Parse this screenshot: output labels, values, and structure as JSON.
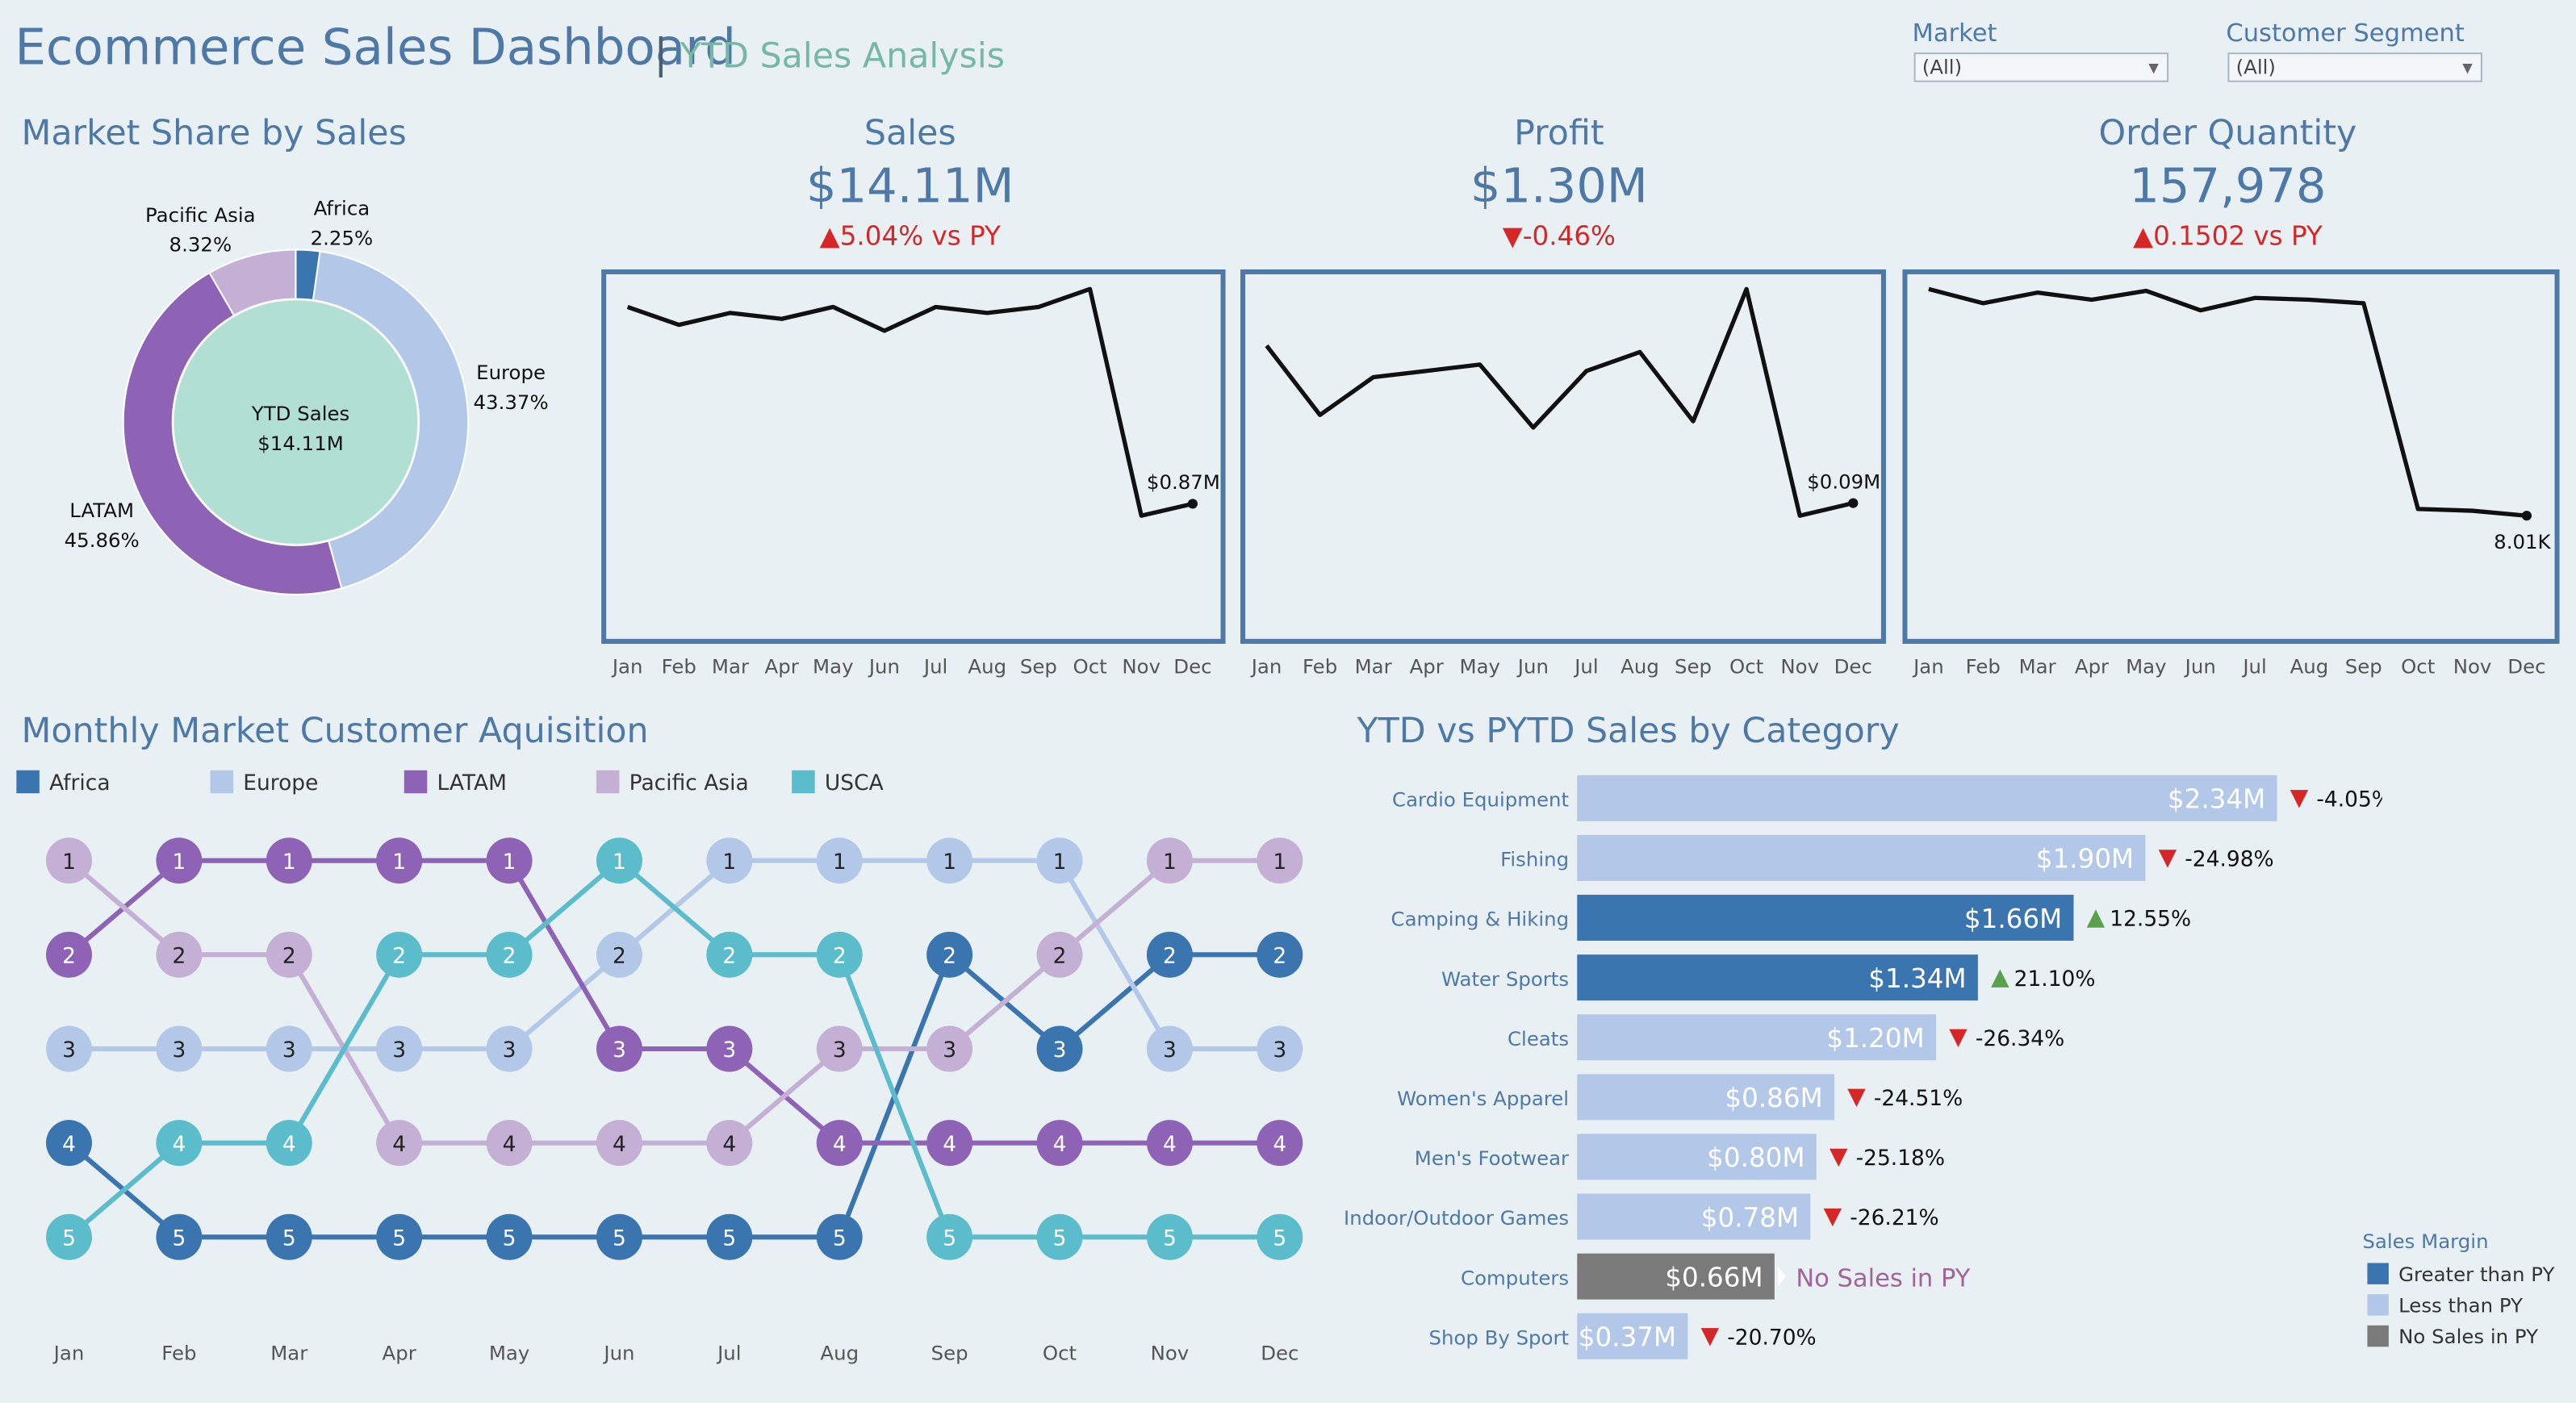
{
  "header": {
    "title": "Ecommerce Sales Dashboard",
    "separator": "|",
    "subtitle": "YTD Sales Analysis"
  },
  "filters": [
    {
      "label": "Market",
      "value": "(All)"
    },
    {
      "label": "Customer Segment",
      "value": "(All)"
    }
  ],
  "market_share": {
    "title": "Market Share by Sales",
    "center_label": "YTD Sales",
    "center_value": "$14.11M",
    "labels": [
      {
        "name": "Pacific Asia",
        "pct": "8.32%"
      },
      {
        "name": "Africa",
        "pct": "2.25%"
      },
      {
        "name": "Europe",
        "pct": "43.37%"
      },
      {
        "name": "LATAM",
        "pct": "45.86%"
      }
    ]
  },
  "kpis": [
    {
      "title": "Sales",
      "value": "$14.11M",
      "arrow": "▲",
      "delta": "5.04% vs PY"
    },
    {
      "title": "Profit",
      "value": "$1.30M",
      "arrow": "▼",
      "delta": "-0.46%"
    },
    {
      "title": "Order Quantity",
      "value": "157,978",
      "arrow": "▲",
      "delta": "0.1502 vs PY"
    }
  ],
  "acquisition": {
    "title": "Monthly Market Customer Aquisition"
  },
  "category": {
    "title": "YTD vs PYTD Sales by Category"
  },
  "sales_margin_legend": {
    "title": "Sales Margin",
    "items": [
      {
        "label": "Greater than PY",
        "color": "#3a75b0"
      },
      {
        "label": "Less than PY",
        "color": "#b3c8e8"
      },
      {
        "label": "No Sales in PY",
        "color": "#7a7a7a"
      }
    ]
  },
  "colors": {
    "Africa": "#3a75b0",
    "Europe": "#b3c8e8",
    "LATAM": "#8e63b6",
    "Pacific Asia": "#c5b0d5",
    "USCA": "#5bbccb",
    "accent": "#4e79a7",
    "up": "#59a14f",
    "down": "#d62728",
    "no_sales_text": "#a06598"
  },
  "chart_data": [
    {
      "type": "pie",
      "title": "Market Share by Sales",
      "categories": [
        "Africa",
        "Europe",
        "LATAM",
        "Pacific Asia"
      ],
      "values": [
        2.25,
        43.37,
        45.86,
        8.32
      ],
      "center_label": "YTD Sales $14.11M"
    },
    {
      "type": "line",
      "title": "Sales",
      "x": [
        "Jan",
        "Feb",
        "Mar",
        "Apr",
        "May",
        "Jun",
        "Jul",
        "Aug",
        "Sep",
        "Oct",
        "Nov",
        "Dec"
      ],
      "series": [
        {
          "values": [
            1.2,
            1.17,
            1.19,
            1.18,
            1.2,
            1.16,
            1.2,
            1.19,
            1.2,
            1.23,
            0.85,
            0.87
          ]
        }
      ],
      "end_label": "$0.87M",
      "grid": false
    },
    {
      "type": "line",
      "title": "Profit",
      "x": [
        "Jan",
        "Feb",
        "Mar",
        "Apr",
        "May",
        "Jun",
        "Jul",
        "Aug",
        "Sep",
        "Oct",
        "Nov",
        "Dec"
      ],
      "series": [
        {
          "values": [
            0.115,
            0.104,
            0.11,
            0.111,
            0.112,
            0.102,
            0.111,
            0.114,
            0.103,
            0.124,
            0.088,
            0.09
          ]
        }
      ],
      "end_label": "$0.09M",
      "grid": false
    },
    {
      "type": "line",
      "title": "Order Quantity",
      "x": [
        "Jan",
        "Feb",
        "Mar",
        "Apr",
        "May",
        "Jun",
        "Jul",
        "Aug",
        "Sep",
        "Oct",
        "Nov",
        "Dec"
      ],
      "series": [
        {
          "values": [
            14.4,
            14.0,
            14.3,
            14.1,
            14.35,
            13.8,
            14.15,
            14.1,
            14.0,
            8.2,
            8.15,
            8.01
          ]
        }
      ],
      "end_label": "8.01K",
      "grid": false
    },
    {
      "type": "line",
      "title": "Monthly Market Customer Aquisition",
      "x": [
        "Jan",
        "Feb",
        "Mar",
        "Apr",
        "May",
        "Jun",
        "Jul",
        "Aug",
        "Sep",
        "Oct",
        "Nov",
        "Dec"
      ],
      "ylim": [
        1,
        5
      ],
      "legend": "top",
      "series": [
        {
          "name": "Africa",
          "values": [
            4,
            5,
            5,
            5,
            5,
            5,
            5,
            5,
            2,
            3,
            2,
            2
          ]
        },
        {
          "name": "Europe",
          "values": [
            3,
            3,
            3,
            3,
            3,
            2,
            1,
            1,
            1,
            1,
            3,
            3
          ]
        },
        {
          "name": "LATAM",
          "values": [
            2,
            1,
            1,
            1,
            1,
            3,
            3,
            4,
            4,
            4,
            4,
            4
          ]
        },
        {
          "name": "Pacific Asia",
          "values": [
            1,
            2,
            2,
            4,
            4,
            4,
            4,
            3,
            3,
            2,
            1,
            1
          ]
        },
        {
          "name": "USCA",
          "values": [
            5,
            4,
            4,
            2,
            2,
            1,
            2,
            2,
            5,
            5,
            5,
            5
          ]
        }
      ]
    },
    {
      "type": "bar",
      "title": "YTD vs PYTD Sales by Category",
      "orientation": "horizontal",
      "categories": [
        "Cardio Equipment",
        "Fishing",
        "Camping & Hiking",
        "Water Sports",
        "Cleats",
        "Women's Apparel",
        "Men's Footwear",
        "Indoor/Outdoor Games",
        "Computers",
        "Shop By Sport"
      ],
      "values": [
        2.34,
        1.9,
        1.66,
        1.34,
        1.2,
        0.86,
        0.8,
        0.78,
        0.66,
        0.37
      ],
      "value_labels": [
        "$2.34M",
        "$1.90M",
        "$1.66M",
        "$1.34M",
        "$1.20M",
        "$0.86M",
        "$0.80M",
        "$0.78M",
        "$0.66M",
        "$0.37M"
      ],
      "margin": [
        "less",
        "less",
        "greater",
        "greater",
        "less",
        "less",
        "less",
        "less",
        "none",
        "less"
      ],
      "change_labels": [
        "-4.05%",
        "-24.98%",
        "12.55%",
        "21.10%",
        "-26.34%",
        "-24.51%",
        "-25.18%",
        "-26.21%",
        "No Sales in PY",
        "-20.70%"
      ]
    }
  ]
}
